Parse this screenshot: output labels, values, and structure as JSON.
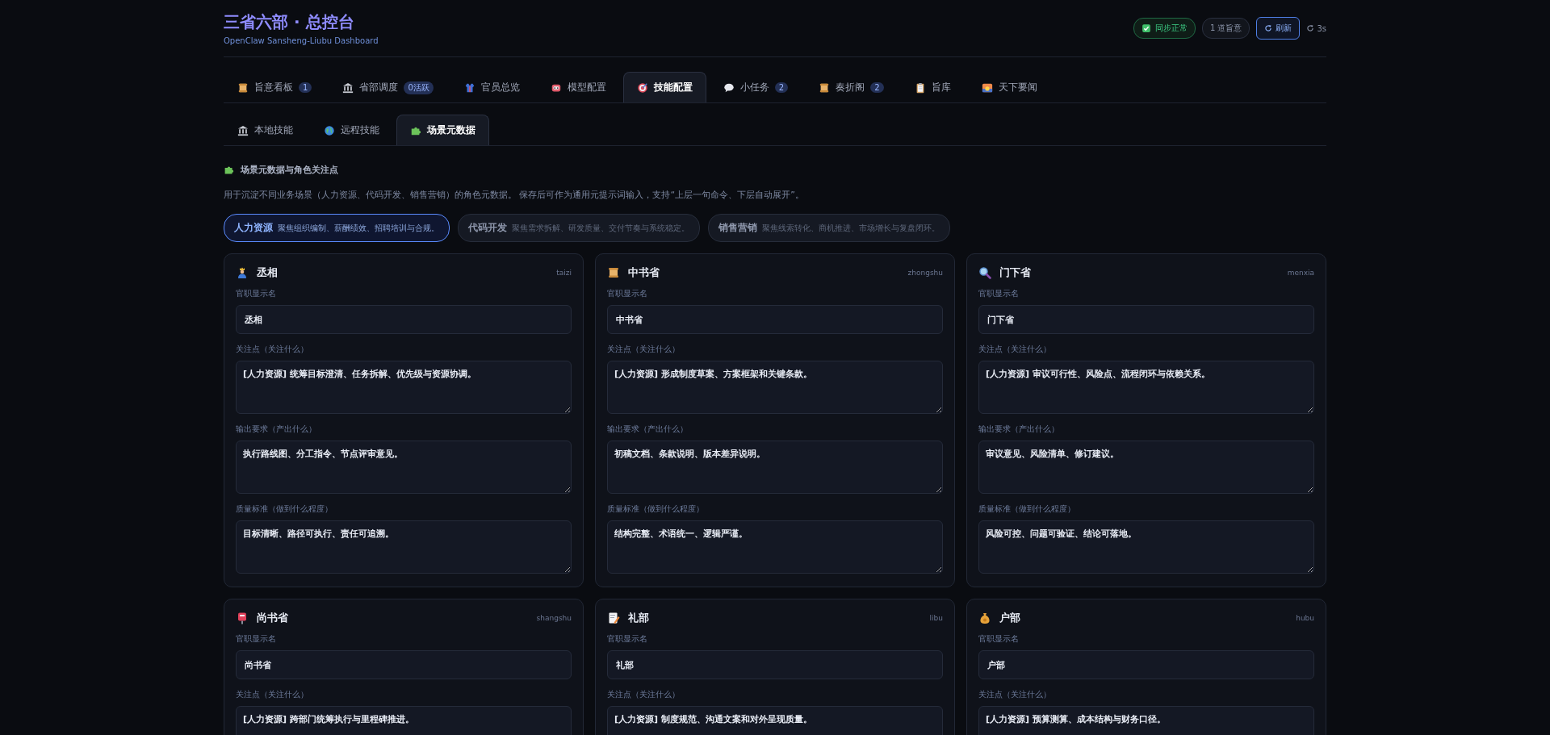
{
  "header": {
    "title": "三省六部 · 总控台",
    "subtitle": "OpenClaw Sansheng-Liubu Dashboard",
    "sync_status": "同步正常",
    "decree_count": "1 道旨意",
    "refresh_button": "刷新",
    "refresh_interval": "3s"
  },
  "tabs": [
    {
      "label": "旨意看板",
      "badge": "1",
      "selected": false
    },
    {
      "label": "省部调度",
      "badge": "0活跃",
      "selected": false
    },
    {
      "label": "官员总览",
      "selected": false
    },
    {
      "label": "模型配置",
      "selected": false
    },
    {
      "label": "技能配置",
      "selected": true
    },
    {
      "label": "小任务",
      "badge": "2",
      "selected": false
    },
    {
      "label": "奏折阁",
      "badge": "2",
      "selected": false
    },
    {
      "label": "旨库",
      "selected": false
    },
    {
      "label": "天下要闻",
      "selected": false
    }
  ],
  "subtabs": [
    {
      "label": "本地技能",
      "selected": false
    },
    {
      "label": "远程技能",
      "selected": false
    },
    {
      "label": "场景元数据",
      "selected": true
    }
  ],
  "section": {
    "title": "场景元数据与角色关注点",
    "description": "用于沉淀不同业务场景（人力资源、代码开发、销售营销）的角色元数据。 保存后可作为通用元提示词输入，支持“上层一句命令、下层自动展开”。"
  },
  "scenarios": [
    {
      "name": "人力资源",
      "summary": "聚焦组织编制、薪酬绩效、招聘培训与合规。",
      "selected": true
    },
    {
      "name": "代码开发",
      "summary": "聚焦需求拆解、研发质量、交付节奏与系统稳定。",
      "selected": false
    },
    {
      "name": "销售营销",
      "summary": "聚焦线索转化、商机推进、市场增长与复盘闭环。",
      "selected": false
    }
  ],
  "roles": [
    {
      "name": "丞相",
      "code": "taizi",
      "fields": [
        {
          "kind": "input",
          "label": "官职显示名",
          "value": "丞相"
        },
        {
          "kind": "textarea",
          "label": "关注点（关注什么）",
          "value": "[人力资源] 统筹目标澄清、任务拆解、优先级与资源协调。"
        },
        {
          "kind": "textarea",
          "label": "输出要求（产出什么）",
          "value": "执行路线图、分工指令、节点评审意见。"
        },
        {
          "kind": "textarea",
          "label": "质量标准（做到什么程度）",
          "value": "目标清晰、路径可执行、责任可追溯。"
        }
      ]
    },
    {
      "name": "中书省",
      "code": "zhongshu",
      "fields": [
        {
          "kind": "input",
          "label": "官职显示名",
          "value": "中书省"
        },
        {
          "kind": "textarea",
          "label": "关注点（关注什么）",
          "value": "[人力资源] 形成制度草案、方案框架和关键条款。"
        },
        {
          "kind": "textarea",
          "label": "输出要求（产出什么）",
          "value": "初稿文档、条款说明、版本差异说明。"
        },
        {
          "kind": "textarea",
          "label": "质量标准（做到什么程度）",
          "value": "结构完整、术语统一、逻辑严谨。"
        }
      ]
    },
    {
      "name": "门下省",
      "code": "menxia",
      "fields": [
        {
          "kind": "input",
          "label": "官职显示名",
          "value": "门下省"
        },
        {
          "kind": "textarea",
          "label": "关注点（关注什么）",
          "value": "[人力资源] 审议可行性、风险点、流程闭环与依赖关系。"
        },
        {
          "kind": "textarea",
          "label": "输出要求（产出什么）",
          "value": "审议意见、风险清单、修订建议。"
        },
        {
          "kind": "textarea",
          "label": "质量标准（做到什么程度）",
          "value": "风险可控、问题可验证、结论可落地。"
        }
      ]
    },
    {
      "name": "尚书省",
      "code": "shangshu",
      "fields": [
        {
          "kind": "input",
          "label": "官职显示名",
          "value": "尚书省"
        },
        {
          "kind": "textarea",
          "label": "关注点（关注什么）",
          "value": "[人力资源] 跨部门统筹执行与里程碑推进。"
        }
      ]
    },
    {
      "name": "礼部",
      "code": "libu",
      "fields": [
        {
          "kind": "input",
          "label": "官职显示名",
          "value": "礼部"
        },
        {
          "kind": "textarea",
          "label": "关注点（关注什么）",
          "value": "[人力资源] 制度规范、沟通文案和对外呈现质量。"
        }
      ]
    },
    {
      "name": "户部",
      "code": "hubu",
      "fields": [
        {
          "kind": "input",
          "label": "官职显示名",
          "value": "户部"
        },
        {
          "kind": "textarea",
          "label": "关注点（关注什么）",
          "value": "[人力资源] 预算测算、成本结构与财务口径。"
        }
      ]
    }
  ]
}
